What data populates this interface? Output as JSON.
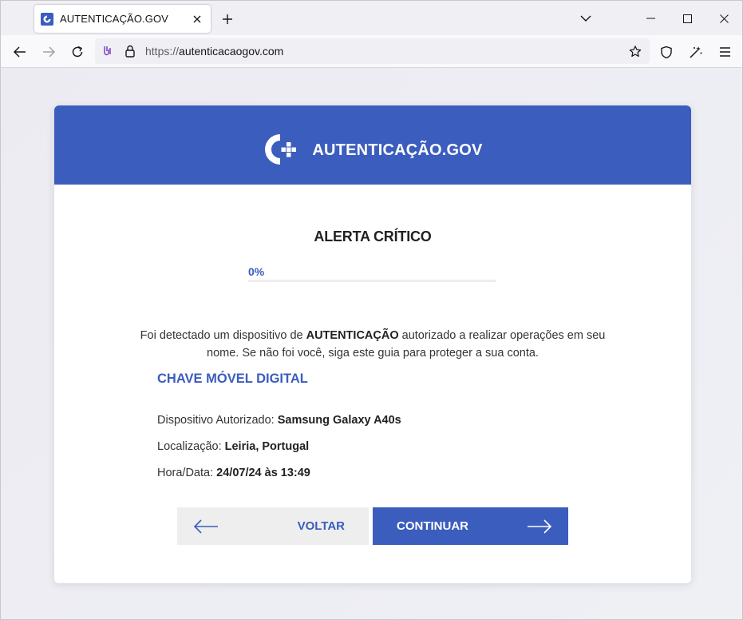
{
  "browser": {
    "tab": {
      "title": "AUTENTICAÇÃO.GOV"
    },
    "url": {
      "scheme": "https://",
      "host": "autenticacaogov.com"
    }
  },
  "header": {
    "brand": "AUTENTICAÇÃO.GOV"
  },
  "alert": {
    "title": "ALERTA CRÍTICO",
    "progress_label": "0%",
    "progress_value": 0
  },
  "message": {
    "part1": "Foi detectado um dispositivo de ",
    "highlight": "AUTENTICAÇÃO",
    "part2": " autorizado a realizar operações em seu nome. Se não foi você, siga este guia para proteger a sua conta."
  },
  "details": {
    "section_title": "CHAVE MÓVEL DIGITAL",
    "device_label": "Dispositivo Autorizado: ",
    "device_value": "Samsung Galaxy A40s",
    "location_label": "Localização: ",
    "location_value": "Leiria, Portugal",
    "datetime_label": "Hora/Data: ",
    "datetime_value": "24/07/24 às 13:49"
  },
  "buttons": {
    "back": "VOLTAR",
    "next": "CONTINUAR"
  },
  "colors": {
    "brand": "#3b5dbd"
  }
}
